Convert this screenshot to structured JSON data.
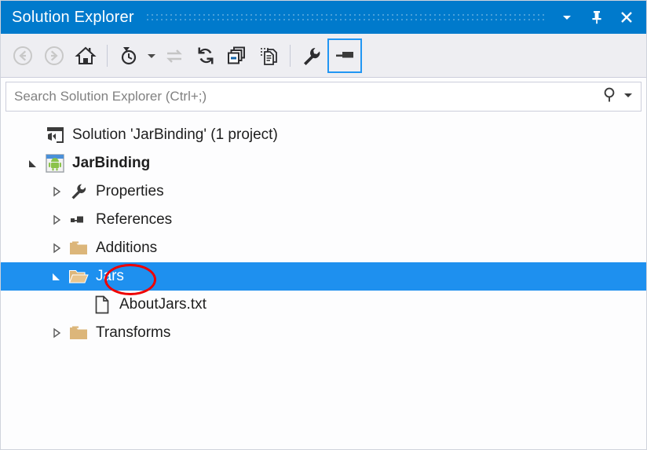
{
  "window": {
    "title": "Solution Explorer",
    "buttons": [
      {
        "name": "dropdown-chevron",
        "label": "▾"
      },
      {
        "name": "pin",
        "label": "Pin"
      },
      {
        "name": "close",
        "label": "Close"
      }
    ]
  },
  "toolbar": {
    "items": [
      {
        "name": "back-button",
        "icon": "back-arrow-icon",
        "tooltip": "Back",
        "enabled": false
      },
      {
        "name": "forward-button",
        "icon": "forward-arrow-icon",
        "tooltip": "Forward",
        "enabled": false
      },
      {
        "name": "home-button",
        "icon": "home-icon",
        "tooltip": "Home",
        "enabled": true
      },
      {
        "name": "pending-changes-filter-button",
        "icon": "clock-filter-icon",
        "tooltip": "Pending Changes Filter",
        "enabled": true
      },
      {
        "name": "sync-with-active-document-button",
        "icon": "sync-arrows-icon",
        "tooltip": "Sync with Active Document",
        "enabled": false
      },
      {
        "name": "refresh-button",
        "icon": "refresh-icon",
        "tooltip": "Refresh",
        "enabled": true
      },
      {
        "name": "collapse-all-button",
        "icon": "collapse-all-icon",
        "tooltip": "Collapse All",
        "enabled": true
      },
      {
        "name": "show-all-files-button",
        "icon": "show-all-files-icon",
        "tooltip": "Show All Files",
        "enabled": true
      },
      {
        "name": "properties-button",
        "icon": "wrench-icon",
        "tooltip": "Properties",
        "enabled": true
      },
      {
        "name": "preview-selected-items-button",
        "icon": "preview-pane-icon",
        "tooltip": "Preview Selected Items",
        "enabled": true,
        "active": true
      }
    ]
  },
  "search": {
    "placeholder": "Search Solution Explorer (Ctrl+;)",
    "value": "",
    "icon": "search-icon",
    "dropdown": "▾"
  },
  "tree": {
    "nodes": [
      {
        "label": "Solution 'JarBinding' (1 project)",
        "icon": "solution-icon",
        "indent": 0,
        "twisty": "none",
        "bold": false,
        "selected": false
      },
      {
        "label": "JarBinding",
        "icon": "android-project-icon",
        "indent": 1,
        "twisty": "expanded",
        "bold": true,
        "selected": false
      },
      {
        "label": "Properties",
        "icon": "wrench-icon",
        "indent": 2,
        "twisty": "collapsed",
        "bold": false,
        "selected": false
      },
      {
        "label": "References",
        "icon": "references-icon",
        "indent": 2,
        "twisty": "collapsed",
        "bold": false,
        "selected": false
      },
      {
        "label": "Additions",
        "icon": "folder-closed-icon",
        "indent": 2,
        "twisty": "collapsed",
        "bold": false,
        "selected": false
      },
      {
        "label": "Jars",
        "icon": "folder-open-icon",
        "indent": 2,
        "twisty": "expanded",
        "bold": false,
        "selected": true
      },
      {
        "label": "AboutJars.txt",
        "icon": "text-file-icon",
        "indent": 3,
        "twisty": "none",
        "bold": false,
        "selected": false
      },
      {
        "label": "Transforms",
        "icon": "folder-closed-icon",
        "indent": 2,
        "twisty": "collapsed",
        "bold": false,
        "selected": false
      }
    ]
  },
  "annotation": {
    "shape": "ellipse",
    "color": "#ee0000",
    "target": "Jars"
  },
  "colors": {
    "title_bar": "#007acc",
    "selection": "#1e90ef",
    "toolbar_bg": "#eeeef2",
    "tree_bg": "#fdfdfe",
    "folder": "#dcb67a",
    "annotation": "#ee0000",
    "active_button_border": "#2196f3"
  }
}
